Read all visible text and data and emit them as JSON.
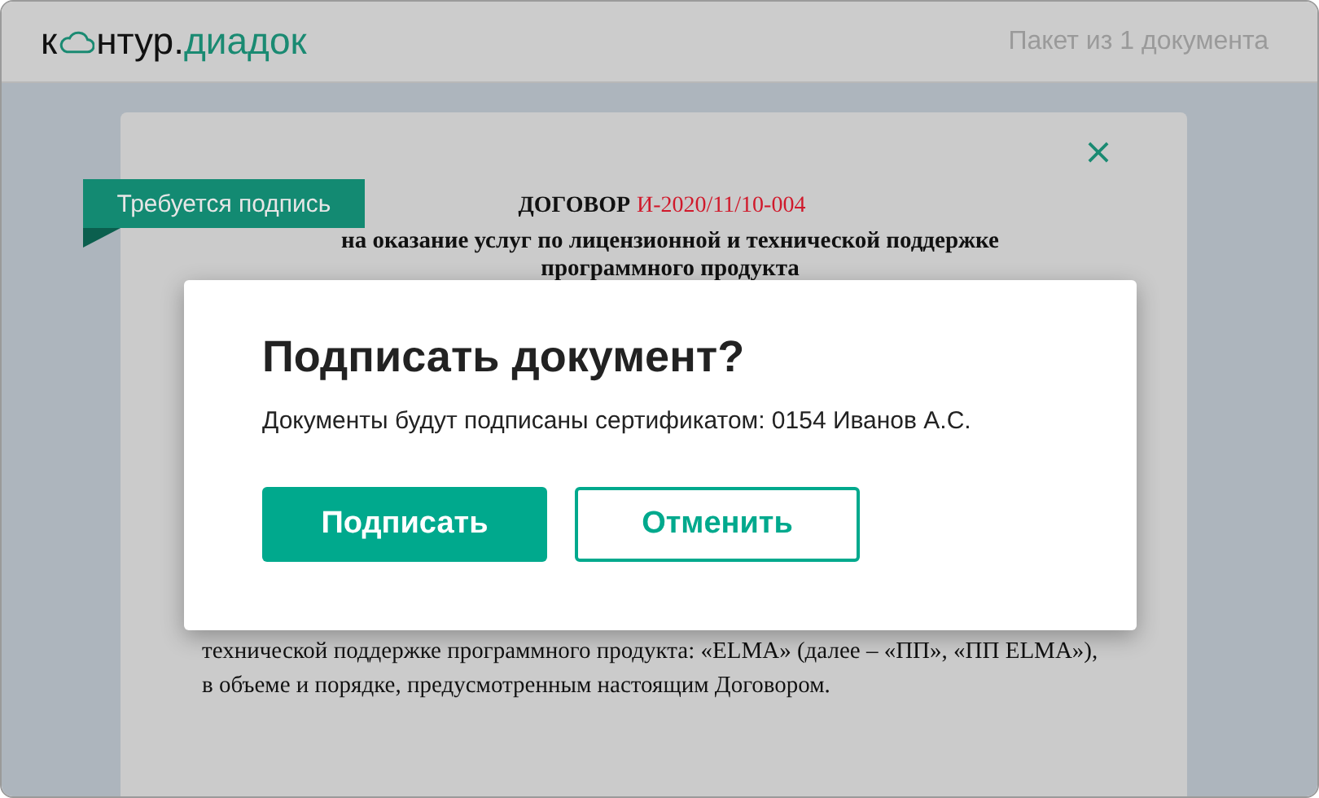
{
  "header": {
    "logo": {
      "part_1": "к",
      "part_2": "нтур.",
      "part_3": "диадок"
    },
    "package_info": "Пакет из 1 документа"
  },
  "document": {
    "badge": "Требуется подпись",
    "title": "ДОГОВОР",
    "number": "И-2020/11/10-004",
    "subtitle_lines": [
      "на оказание услуг по лицензионной и технической поддержке",
      "программного продукта"
    ],
    "body_lines": [
      "технической поддержке программного продукта: «ELMA» (далее – «ПП», «ПП ELMA»),",
      "в объеме и порядке, предусмотренным настоящим Договором."
    ]
  },
  "dialog": {
    "title": "Подписать документ?",
    "message": "Документы будут подписаны сертификатом: 0154 Иванов А.С.",
    "buttons": [
      {
        "label": "Подписать",
        "kind": "primary"
      },
      {
        "label": "Отменить",
        "kind": "secondary"
      }
    ]
  }
}
